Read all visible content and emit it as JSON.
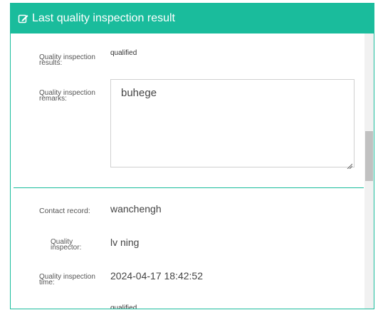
{
  "header": {
    "title": "Last quality inspection result",
    "icon": "edit-icon",
    "bg_color": "#1abc9c"
  },
  "fields": {
    "results": {
      "label": "Quality inspection results:",
      "value": "qualified"
    },
    "remarks": {
      "label": "Quality inspection remarks:",
      "value": "buhege"
    },
    "contact": {
      "label": "Contact record:",
      "value": "wanchengh"
    },
    "inspector": {
      "label": "Quality inspector:",
      "value": "lv ning"
    },
    "time": {
      "label": "Quality inspection time:",
      "value": "2024-04-17 18:42:52"
    },
    "next_value": "qualified"
  }
}
